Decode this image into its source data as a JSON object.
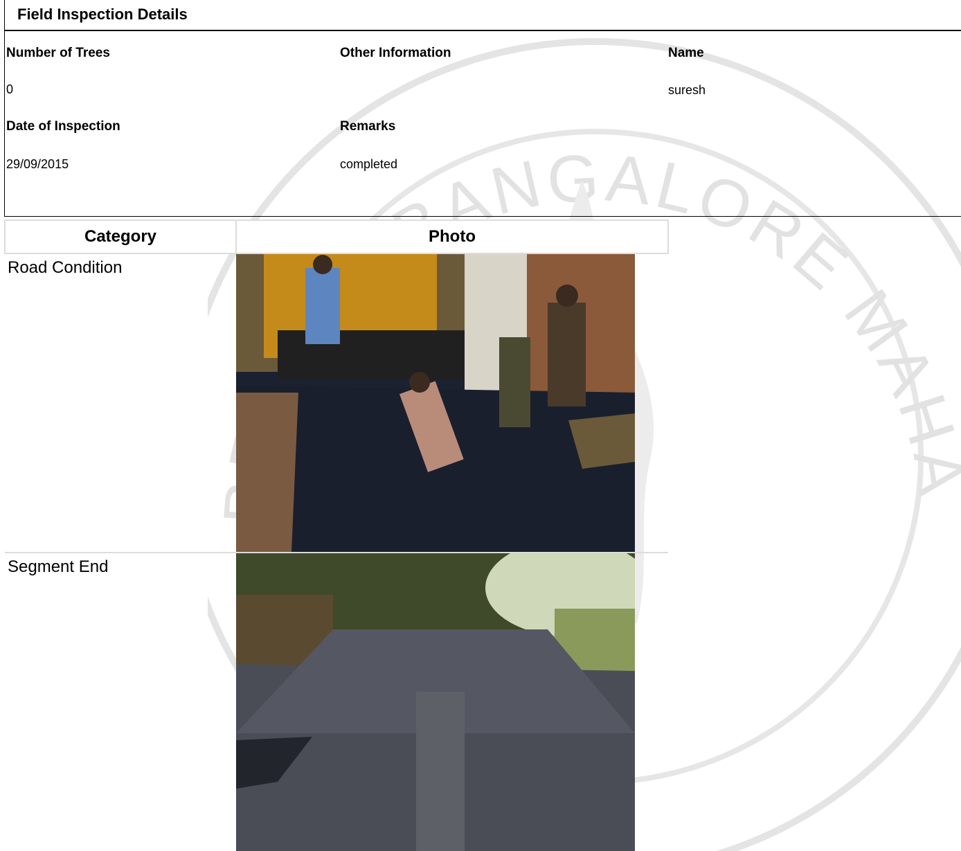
{
  "panel": {
    "title": "Field Inspection Details",
    "fields": {
      "number_of_trees": {
        "label": "Number of Trees",
        "value": "0"
      },
      "other_information": {
        "label": "Other Information",
        "value": ""
      },
      "name": {
        "label": "Name",
        "value": "suresh"
      },
      "date_of_inspection": {
        "label": "Date of Inspection",
        "value": "29/09/2015"
      },
      "remarks": {
        "label": "Remarks",
        "value": "completed"
      }
    }
  },
  "table": {
    "headers": [
      "Category",
      "Photo"
    ],
    "rows": [
      {
        "category": "Road Condition",
        "photo_desc": "workers laying fresh asphalt on road"
      },
      {
        "category": "Segment End",
        "photo_desc": "finished asphalt road under trees"
      }
    ]
  },
  "watermark": {
    "text": "BRUHAT BANGALORE MAHANAGARA PALIKE"
  },
  "colors": {
    "border": "#dcdcdc",
    "asphalt": "#1a1f2e"
  }
}
